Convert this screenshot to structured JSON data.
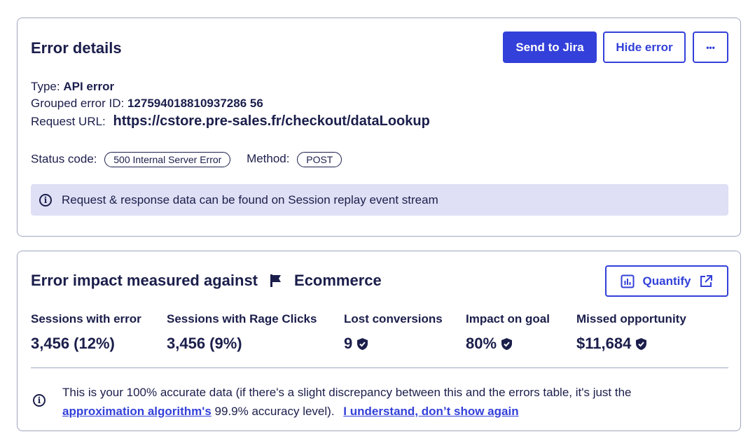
{
  "error_details": {
    "title": "Error details",
    "buttons": {
      "send_to_jira": "Send to Jira",
      "hide_error": "Hide error",
      "more": "•••"
    },
    "type_label": "Type:",
    "type_value": "API error",
    "grouped_label": "Grouped error ID:",
    "grouped_value": "127594018810937286 56",
    "request_url_label": "Request URL:",
    "request_url_value": "https://cstore.pre-sales.fr/checkout/dataLookup",
    "status_code_label": "Status code:",
    "status_code_value": "500 Internal Server Error",
    "method_label": "Method:",
    "method_value": "POST",
    "info_banner": "Request & response data can be found on Session replay event stream"
  },
  "impact": {
    "title_prefix": "Error impact measured against",
    "goal_name": "Ecommerce",
    "goal_icon": "flag-icon",
    "quantify_label": "Quantify",
    "metrics": [
      {
        "label": "Sessions with error",
        "value": "3,456 (12%)",
        "verified": false
      },
      {
        "label": "Sessions with Rage Clicks",
        "value": "3,456 (9%)",
        "verified": false
      },
      {
        "label": "Lost conversions",
        "value": "9",
        "verified": true
      },
      {
        "label": "Impact on goal",
        "value": "80%",
        "verified": true
      },
      {
        "label": "Missed opportunity",
        "value": "$11,684",
        "verified": true
      }
    ],
    "note_text_1": "This is your 100% accurate data (if there's a slight discrepancy between this and the errors table, it's just the",
    "note_link_1": "approximation algorithm's",
    "note_text_2": "99.9% accuracy level).",
    "note_link_2": "I understand, don’t show again"
  },
  "colors": {
    "primary": "#3340d9",
    "text": "#1b1e4b",
    "banner_bg": "#dfe0f5",
    "border": "#9fa6c0"
  }
}
